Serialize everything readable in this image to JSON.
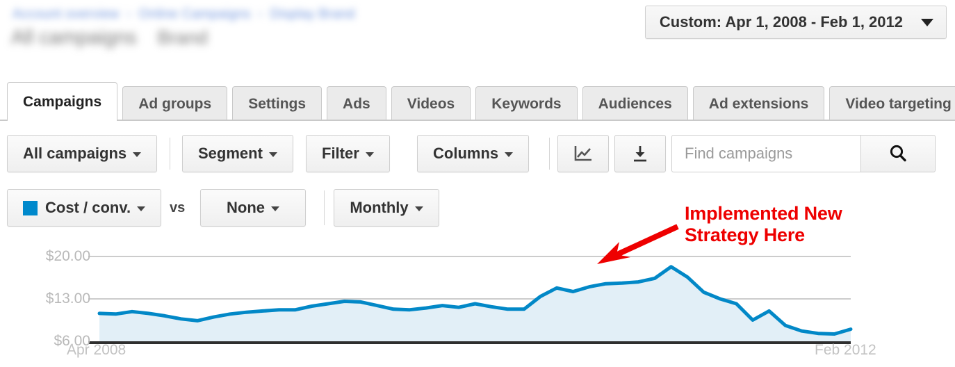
{
  "header": {
    "breadcrumb_redacted_1": "Account overview",
    "breadcrumb_sep": "›",
    "breadcrumb_redacted_2": "Online Campaigns",
    "breadcrumb_redacted_3": "Display",
    "breadcrumb_redacted_4": "Brand",
    "title_redacted": "All campaigns",
    "subtitle_redacted": "Brand",
    "date_range": {
      "label": "Custom: Apr 1, 2008 - Feb 1, 2012",
      "caret_icon": "chevron-down-icon"
    }
  },
  "tabs": [
    {
      "label": "Campaigns",
      "active": true
    },
    {
      "label": "Ad groups",
      "active": false
    },
    {
      "label": "Settings",
      "active": false
    },
    {
      "label": "Ads",
      "active": false
    },
    {
      "label": "Videos",
      "active": false
    },
    {
      "label": "Keywords",
      "active": false
    },
    {
      "label": "Audiences",
      "active": false
    },
    {
      "label": "Ad extensions",
      "active": false
    },
    {
      "label": "Video targeting",
      "active": false
    }
  ],
  "toolbar": {
    "all_campaigns": "All campaigns",
    "segment": "Segment",
    "filter": "Filter",
    "columns": "Columns",
    "chart_icon": "line-chart-icon",
    "download_icon": "download-icon",
    "search_placeholder": "Find campaigns",
    "search_value": "",
    "search_icon": "magnifier-icon",
    "caret_icon": "chevron-down-icon"
  },
  "metric_bar": {
    "primary_metric": "Cost / conv.",
    "primary_swatch_color": "#0089cc",
    "vs": "vs",
    "secondary_metric": "None",
    "granularity": "Monthly",
    "caret_icon": "chevron-down-icon"
  },
  "annotation": {
    "line1": "Implemented New",
    "line2": "Strategy Here",
    "color": "#ee0000",
    "arrow_icon": "arrow-down-left-icon"
  },
  "chart_data": {
    "type": "area",
    "title": "Cost / conv.",
    "xlabel": "",
    "ylabel": "Cost / conv.",
    "series_color": "#0288c7",
    "fill_color": "#e2eff7",
    "grid": true,
    "legend_position": "toolbar",
    "ylim": [
      6.0,
      20.0
    ],
    "ytick_labels": [
      "$20.00",
      "$13.00",
      "$6.00"
    ],
    "ytick_values": [
      20.0,
      13.0,
      6.0
    ],
    "xtick_labels": [
      "Apr 2008",
      "Feb 2012"
    ],
    "x_start": "Apr 2008",
    "x_end": "Feb 2012",
    "granularity": "Monthly",
    "x": [
      "Apr 2008",
      "May 2008",
      "Jun 2008",
      "Jul 2008",
      "Aug 2008",
      "Sep 2008",
      "Oct 2008",
      "Nov 2008",
      "Dec 2008",
      "Jan 2009",
      "Feb 2009",
      "Mar 2009",
      "Apr 2009",
      "May 2009",
      "Jun 2009",
      "Jul 2009",
      "Aug 2009",
      "Sep 2009",
      "Oct 2009",
      "Nov 2009",
      "Dec 2009",
      "Jan 2010",
      "Feb 2010",
      "Mar 2010",
      "Apr 2010",
      "May 2010",
      "Jun 2010",
      "Jul 2010",
      "Aug 2010",
      "Sep 2010",
      "Oct 2010",
      "Nov 2010",
      "Dec 2010",
      "Jan 2011",
      "Feb 2011",
      "Mar 2011",
      "Apr 2011",
      "May 2011",
      "Jun 2011",
      "Jul 2011",
      "Aug 2011",
      "Sep 2011",
      "Oct 2011",
      "Nov 2011",
      "Dec 2011",
      "Jan 2012",
      "Feb 2012"
    ],
    "values": [
      10.6,
      10.5,
      10.9,
      10.6,
      10.2,
      9.7,
      9.4,
      10.0,
      10.5,
      10.8,
      11.0,
      11.2,
      11.2,
      11.8,
      12.2,
      12.6,
      12.5,
      11.9,
      11.3,
      11.2,
      11.5,
      11.9,
      11.6,
      12.2,
      11.7,
      11.3,
      11.3,
      13.4,
      14.8,
      14.2,
      15.0,
      15.5,
      15.6,
      15.8,
      16.4,
      18.3,
      16.6,
      14.1,
      13.0,
      12.2,
      9.5,
      11.0,
      8.6,
      7.7,
      7.3,
      7.2,
      8.0
    ],
    "peak_value": 18.3,
    "peak_label": "Mar 2011"
  }
}
